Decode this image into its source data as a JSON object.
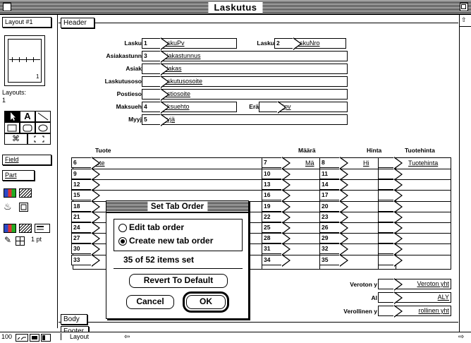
{
  "window": {
    "title": "Laskutus"
  },
  "palette": {
    "layout_label": "Layout #1",
    "layouts_caption": "Layouts:",
    "layouts_count": "1",
    "book_page": "1",
    "field_label": "Field",
    "part_label": "Part",
    "line_width": "1 pt",
    "zoom": "100"
  },
  "parts": {
    "header": "Header",
    "body": "Body",
    "footer": "Footer"
  },
  "fields": {
    "lasku_pvm": {
      "label": "Lasku",
      "num": "1",
      "value": "askuPv"
    },
    "lasku_nro": {
      "label": "Lasku",
      "num": "2",
      "value": "askuNro"
    },
    "asiakastunnus": {
      "label": "Asiakastunn",
      "num": "3",
      "value": "siakastunnus"
    },
    "asiakas": {
      "label": "Asiak",
      "value": "siakas"
    },
    "laskutusosoite": {
      "label": "Laskutusoso",
      "value": "askutusosoite"
    },
    "postiosoite": {
      "label": "Postieso",
      "value": "ostiosoite"
    },
    "maksuehto": {
      "label": "Maksueh",
      "num": "4",
      "value": "aksuehto"
    },
    "erapaiva": {
      "label": "Erä",
      "value": "äpv"
    },
    "myyja": {
      "label": "Myyj",
      "num": "5",
      "value": "yyjä"
    }
  },
  "columns": {
    "tuote": "Tuote",
    "maara": "Määrä",
    "hinta": "Hinta",
    "tuotehinta": "Tuotehinta"
  },
  "row1": {
    "tuote_num": "6",
    "tuote": "uote",
    "maara_num": "7",
    "maara": "Mä",
    "hinta_num": "8",
    "hinta": "Hi",
    "tuotehinta": "Tuotehinta"
  },
  "rows": [
    {
      "a": "9",
      "b": "10",
      "c": "11"
    },
    {
      "a": "12",
      "b": "13",
      "c": "14"
    },
    {
      "a": "15",
      "b": "16",
      "c": "17"
    },
    {
      "a": "18",
      "b": "19",
      "c": "20"
    },
    {
      "a": "21",
      "b": "22",
      "c": "23"
    },
    {
      "a": "24",
      "b": "25",
      "c": "26"
    },
    {
      "a": "27",
      "b": "28",
      "c": "29"
    },
    {
      "a": "30",
      "b": "31",
      "c": "32"
    },
    {
      "a": "33",
      "b": "34",
      "c": "35"
    }
  ],
  "totals": {
    "veroton_label": "Veroton y",
    "veroton_value": "Veroton yht",
    "alv_label": "Al",
    "alv_value": "ALY",
    "verollinen_label": "Verollinen y",
    "verollinen_value": "rollinen yht"
  },
  "dialog": {
    "title": "Set Tab Order",
    "option_edit": "Edit tab order",
    "option_create": "Create new tab order",
    "status": "35 of 52 items set",
    "revert_button": "Revert To Default",
    "cancel_button": "Cancel",
    "ok_button": "OK"
  },
  "statusbar": {
    "mode": "Layout"
  }
}
